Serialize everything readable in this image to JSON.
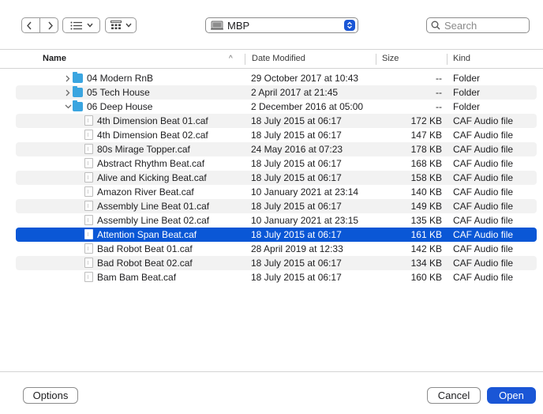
{
  "toolbar": {
    "back_icon": "chevron-left-icon",
    "forward_icon": "chevron-right-icon",
    "view_icon": "list-view-icon",
    "group_icon": "grid-group-icon",
    "location": "MBP",
    "location_icon": "drive-icon",
    "search_placeholder": "Search"
  },
  "columns": {
    "name": "Name",
    "date": "Date Modified",
    "size": "Size",
    "kind": "Kind"
  },
  "rows": [
    {
      "name": "04 Modern RnB",
      "date": "29 October 2017 at 10:43",
      "size": "--",
      "kind": "Folder",
      "type": "folder",
      "expanded": false
    },
    {
      "name": "05 Tech House",
      "date": "2 April 2017 at 21:45",
      "size": "--",
      "kind": "Folder",
      "type": "folder",
      "expanded": false
    },
    {
      "name": "06 Deep House",
      "date": "2 December 2016 at 05:00",
      "size": "--",
      "kind": "Folder",
      "type": "folder",
      "expanded": true
    },
    {
      "name": "4th Dimension Beat 01.caf",
      "date": "18 July 2015 at 06:17",
      "size": "172 KB",
      "kind": "CAF Audio file",
      "type": "file"
    },
    {
      "name": "4th Dimension Beat 02.caf",
      "date": "18 July 2015 at 06:17",
      "size": "147 KB",
      "kind": "CAF Audio file",
      "type": "file"
    },
    {
      "name": "80s Mirage Topper.caf",
      "date": "24 May 2016 at 07:23",
      "size": "178 KB",
      "kind": "CAF Audio file",
      "type": "file"
    },
    {
      "name": "Abstract Rhythm Beat.caf",
      "date": "18 July 2015 at 06:17",
      "size": "168 KB",
      "kind": "CAF Audio file",
      "type": "file"
    },
    {
      "name": "Alive and Kicking Beat.caf",
      "date": "18 July 2015 at 06:17",
      "size": "158 KB",
      "kind": "CAF Audio file",
      "type": "file"
    },
    {
      "name": "Amazon River Beat.caf",
      "date": "10 January 2021 at 23:14",
      "size": "140 KB",
      "kind": "CAF Audio file",
      "type": "file"
    },
    {
      "name": "Assembly Line Beat 01.caf",
      "date": "18 July 2015 at 06:17",
      "size": "149 KB",
      "kind": "CAF Audio file",
      "type": "file"
    },
    {
      "name": "Assembly Line Beat 02.caf",
      "date": "10 January 2021 at 23:15",
      "size": "135 KB",
      "kind": "CAF Audio file",
      "type": "file"
    },
    {
      "name": "Attention Span Beat.caf",
      "date": "18 July 2015 at 06:17",
      "size": "161 KB",
      "kind": "CAF Audio file",
      "type": "file",
      "selected": true
    },
    {
      "name": "Bad Robot Beat 01.caf",
      "date": "28 April 2019 at 12:33",
      "size": "142 KB",
      "kind": "CAF Audio file",
      "type": "file"
    },
    {
      "name": "Bad Robot Beat 02.caf",
      "date": "18 July 2015 at 06:17",
      "size": "134 KB",
      "kind": "CAF Audio file",
      "type": "file"
    },
    {
      "name": "Bam Bam Beat.caf",
      "date": "18 July 2015 at 06:17",
      "size": "160 KB",
      "kind": "CAF Audio file",
      "type": "file"
    }
  ],
  "footer": {
    "options_label": "Options",
    "cancel_label": "Cancel",
    "open_label": "Open"
  },
  "colors": {
    "accent": "#1a56d6",
    "selection": "#0a57d6",
    "folder": "#3aa5e0",
    "alt_row": "#f2f2f2"
  }
}
